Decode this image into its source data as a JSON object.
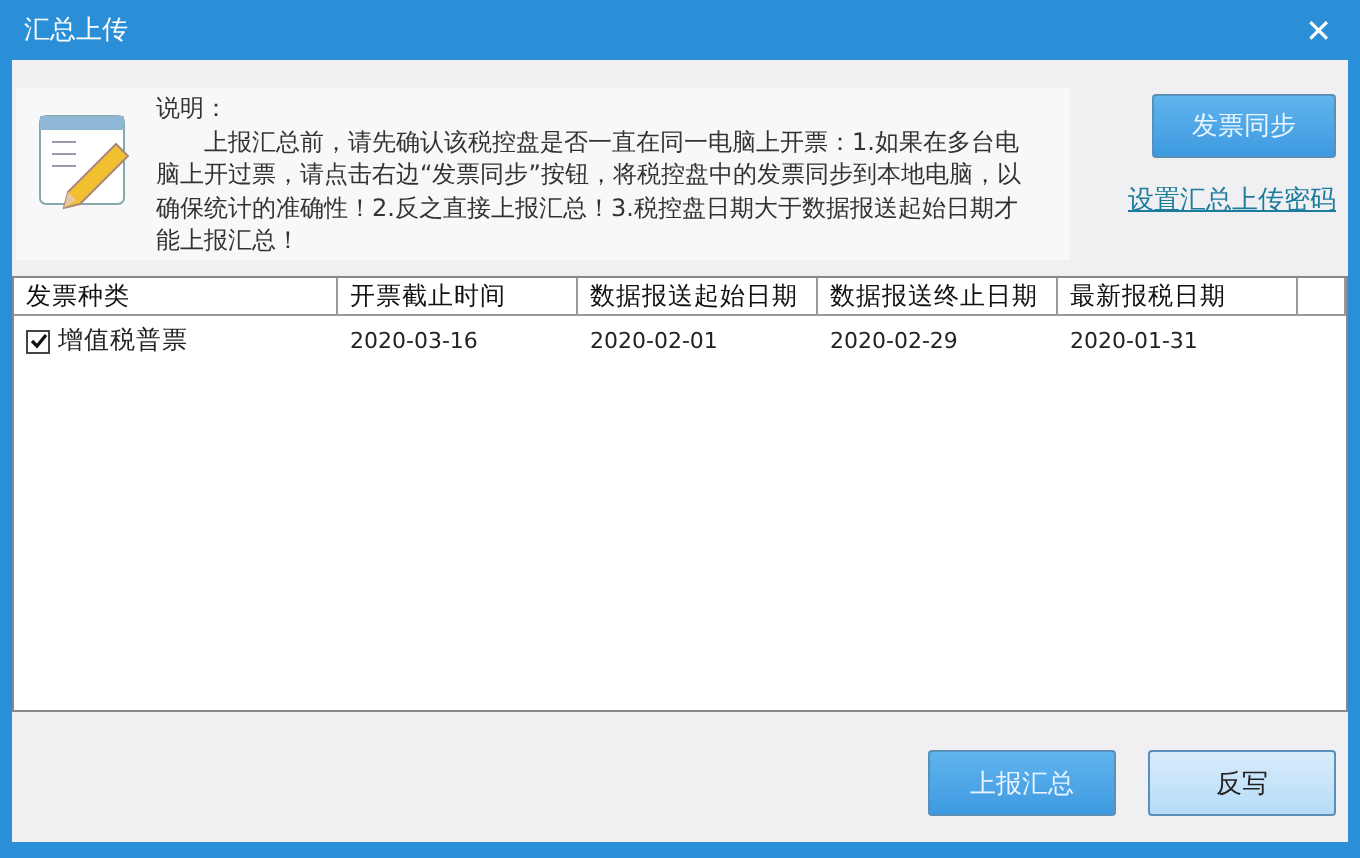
{
  "window": {
    "title": "汇总上传",
    "close": "✕"
  },
  "notice": {
    "heading": "说明：",
    "body": "上报汇总前，请先确认该税控盘是否一直在同一电脑上开票：1.如果在多台电脑上开过票，请点击右边“发票同步”按钮，将税控盘中的发票同步到本地电脑，以确保统计的准确性！2.反之直接上报汇总！3.税控盘日期大于数据报送起始日期才能上报汇总！"
  },
  "sync_button": "发票同步",
  "password_link": "设置汇总上传密码",
  "table": {
    "columns": [
      "发票种类",
      "开票截止时间",
      "数据报送起始日期",
      "数据报送终止日期",
      "最新报税日期"
    ],
    "rows": [
      {
        "checked": true,
        "cells": [
          "增值税普票",
          "2020-03-16",
          "2020-02-01",
          "2020-02-29",
          "2020-01-31"
        ]
      }
    ]
  },
  "buttons": [
    {
      "label": "上报汇总",
      "kind": "primary"
    },
    {
      "label": "反写",
      "kind": "secondary"
    }
  ]
}
